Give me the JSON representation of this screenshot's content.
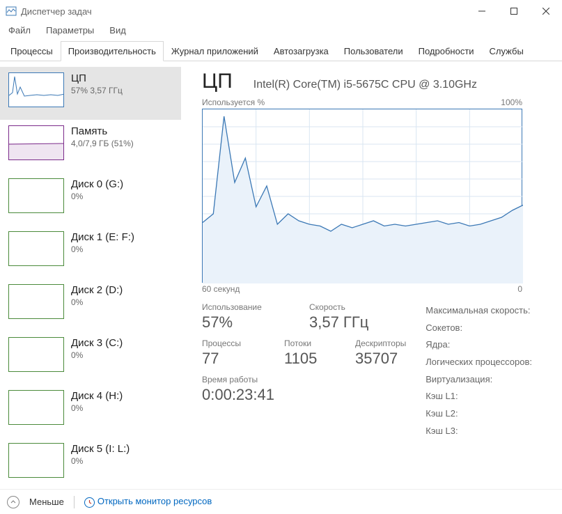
{
  "window": {
    "title": "Диспетчер задач"
  },
  "menu": {
    "file": "Файл",
    "options": "Параметры",
    "view": "Вид"
  },
  "tabs": {
    "processes": "Процессы",
    "performance": "Производительность",
    "app_history": "Журнал приложений",
    "startup": "Автозагрузка",
    "users": "Пользователи",
    "details": "Подробности",
    "services": "Службы",
    "active": "performance"
  },
  "sidebar": [
    {
      "title": "ЦП",
      "sub": "57% 3,57 ГГц",
      "color": "#3b78b5",
      "selected": true,
      "type": "cpu"
    },
    {
      "title": "Память",
      "sub": "4,0/7,9 ГБ (51%)",
      "color": "#7b2a8a",
      "selected": false,
      "type": "mem"
    },
    {
      "title": "Диск 0 (G:)",
      "sub": "0%",
      "color": "#4a8a3a",
      "selected": false,
      "type": "disk"
    },
    {
      "title": "Диск 1 (E: F:)",
      "sub": "0%",
      "color": "#4a8a3a",
      "selected": false,
      "type": "disk"
    },
    {
      "title": "Диск 2 (D:)",
      "sub": "0%",
      "color": "#4a8a3a",
      "selected": false,
      "type": "disk"
    },
    {
      "title": "Диск 3 (C:)",
      "sub": "0%",
      "color": "#4a8a3a",
      "selected": false,
      "type": "disk"
    },
    {
      "title": "Диск 4 (H:)",
      "sub": "0%",
      "color": "#4a8a3a",
      "selected": false,
      "type": "disk"
    },
    {
      "title": "Диск 5 (I: L:)",
      "sub": "0%",
      "color": "#4a8a3a",
      "selected": false,
      "type": "disk"
    }
  ],
  "main": {
    "title": "ЦП",
    "model": "Intel(R) Core(TM) i5-5675C CPU @ 3.10GHz",
    "y_label": "Используется %",
    "y_max": "100%",
    "x_left": "60 секунд",
    "x_right": "0"
  },
  "stats": {
    "usage_label": "Использование",
    "usage_val": "57%",
    "speed_label": "Скорость",
    "speed_val": "3,57 ГГц",
    "proc_label": "Процессы",
    "proc_val": "77",
    "threads_label": "Потоки",
    "threads_val": "1105",
    "handles_label": "Дескрипторы",
    "handles_val": "35707",
    "uptime_label": "Время работы",
    "uptime_val": "0:00:23:41",
    "right": {
      "max_speed": "Максимальная скорость:",
      "sockets": "Сокетов:",
      "cores": "Ядра:",
      "logical": "Логических процессоров:",
      "virt": "Виртуализация:",
      "l1": "Кэш L1:",
      "l2": "Кэш L2:",
      "l3": "Кэш L3:"
    }
  },
  "footer": {
    "less": "Меньше",
    "open_monitor": "Открыть монитор ресурсов"
  },
  "chart_data": {
    "type": "line",
    "title": "Используется %",
    "xlabel": "60 секунд → 0",
    "ylabel": "%",
    "ylim": [
      0,
      100
    ],
    "xlim_seconds": [
      60,
      0
    ],
    "x": [
      60,
      58,
      56,
      54,
      52,
      50,
      48,
      46,
      44,
      42,
      40,
      38,
      36,
      34,
      32,
      30,
      28,
      26,
      24,
      22,
      20,
      18,
      16,
      14,
      12,
      10,
      8,
      6,
      4,
      2,
      0
    ],
    "values": [
      35,
      40,
      96,
      58,
      72,
      44,
      56,
      34,
      40,
      36,
      34,
      33,
      30,
      34,
      32,
      34,
      36,
      33,
      34,
      33,
      34,
      35,
      36,
      34,
      35,
      33,
      34,
      36,
      38,
      42,
      45
    ]
  }
}
